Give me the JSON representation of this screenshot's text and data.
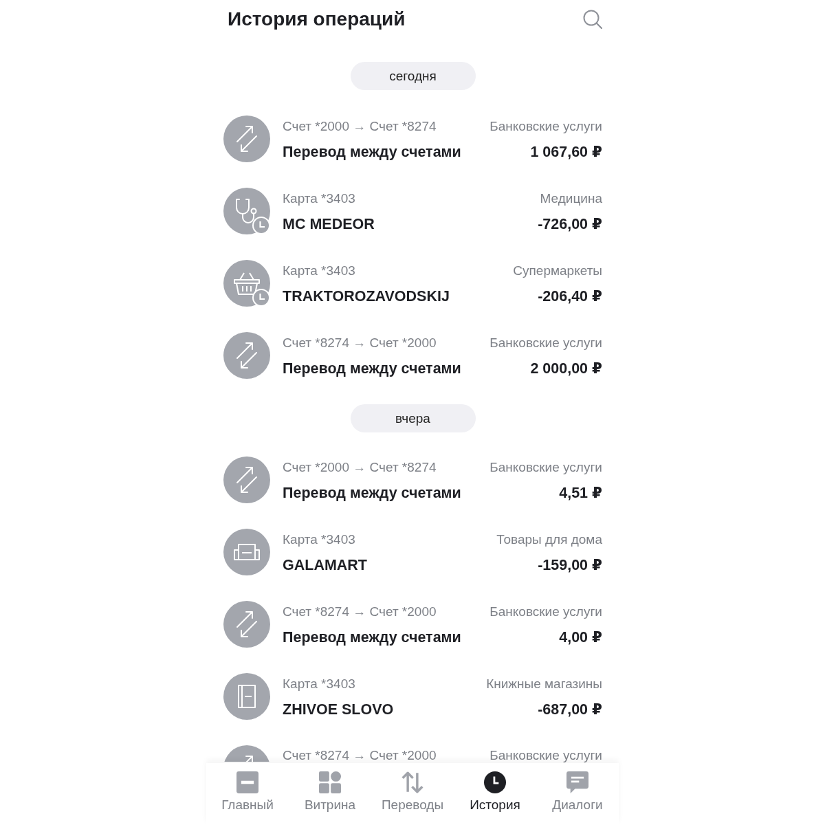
{
  "header": {
    "title": "История операций"
  },
  "sections": [
    {
      "date": "сегодня",
      "operations": [
        {
          "kind": "transfer",
          "pending": false,
          "account": "Счет *2000 → Счет *8274",
          "category": "Банковские услуги",
          "title": "Перевод между счетами",
          "amount": "1 067,60 ₽"
        },
        {
          "kind": "medicine",
          "pending": true,
          "account": "Карта *3403",
          "category": "Медицина",
          "title": "MC MEDEOR",
          "amount": "-726,00 ₽"
        },
        {
          "kind": "supermarket",
          "pending": true,
          "account": "Карта *3403",
          "category": "Супермаркеты",
          "title": "TRAKTOROZAVODSKIJ",
          "amount": "-206,40 ₽"
        },
        {
          "kind": "transfer",
          "pending": false,
          "account": "Счет *8274 → Счет *2000",
          "category": "Банковские услуги",
          "title": "Перевод между счетами",
          "amount": "2 000,00 ₽"
        }
      ]
    },
    {
      "date": "вчера",
      "operations": [
        {
          "kind": "transfer",
          "pending": false,
          "account": "Счет *2000 → Счет *8274",
          "category": "Банковские услуги",
          "title": "Перевод между счетами",
          "amount": "4,51 ₽"
        },
        {
          "kind": "home",
          "pending": false,
          "account": "Карта *3403",
          "category": "Товары для дома",
          "title": "GALAMART",
          "amount": "-159,00 ₽"
        },
        {
          "kind": "transfer",
          "pending": false,
          "account": "Счет *8274 → Счет *2000",
          "category": "Банковские услуги",
          "title": "Перевод между счетами",
          "amount": "4,00 ₽"
        },
        {
          "kind": "books",
          "pending": false,
          "account": "Карта *3403",
          "category": "Книжные магазины",
          "title": "ZHIVOE SLOVO",
          "amount": "-687,00 ₽"
        },
        {
          "kind": "transfer",
          "pending": false,
          "account": "Счет *8274 → Счет *2000",
          "category": "Банковские услуги"
        }
      ]
    }
  ],
  "nav": [
    {
      "kind": "main",
      "label": "Главный",
      "selected": false
    },
    {
      "kind": "showcase",
      "label": "Витрина",
      "selected": false
    },
    {
      "kind": "transfers",
      "label": "Переводы",
      "selected": false
    },
    {
      "kind": "history",
      "label": "История",
      "selected": true
    },
    {
      "kind": "dialogs",
      "label": "Диалоги",
      "selected": false
    }
  ]
}
